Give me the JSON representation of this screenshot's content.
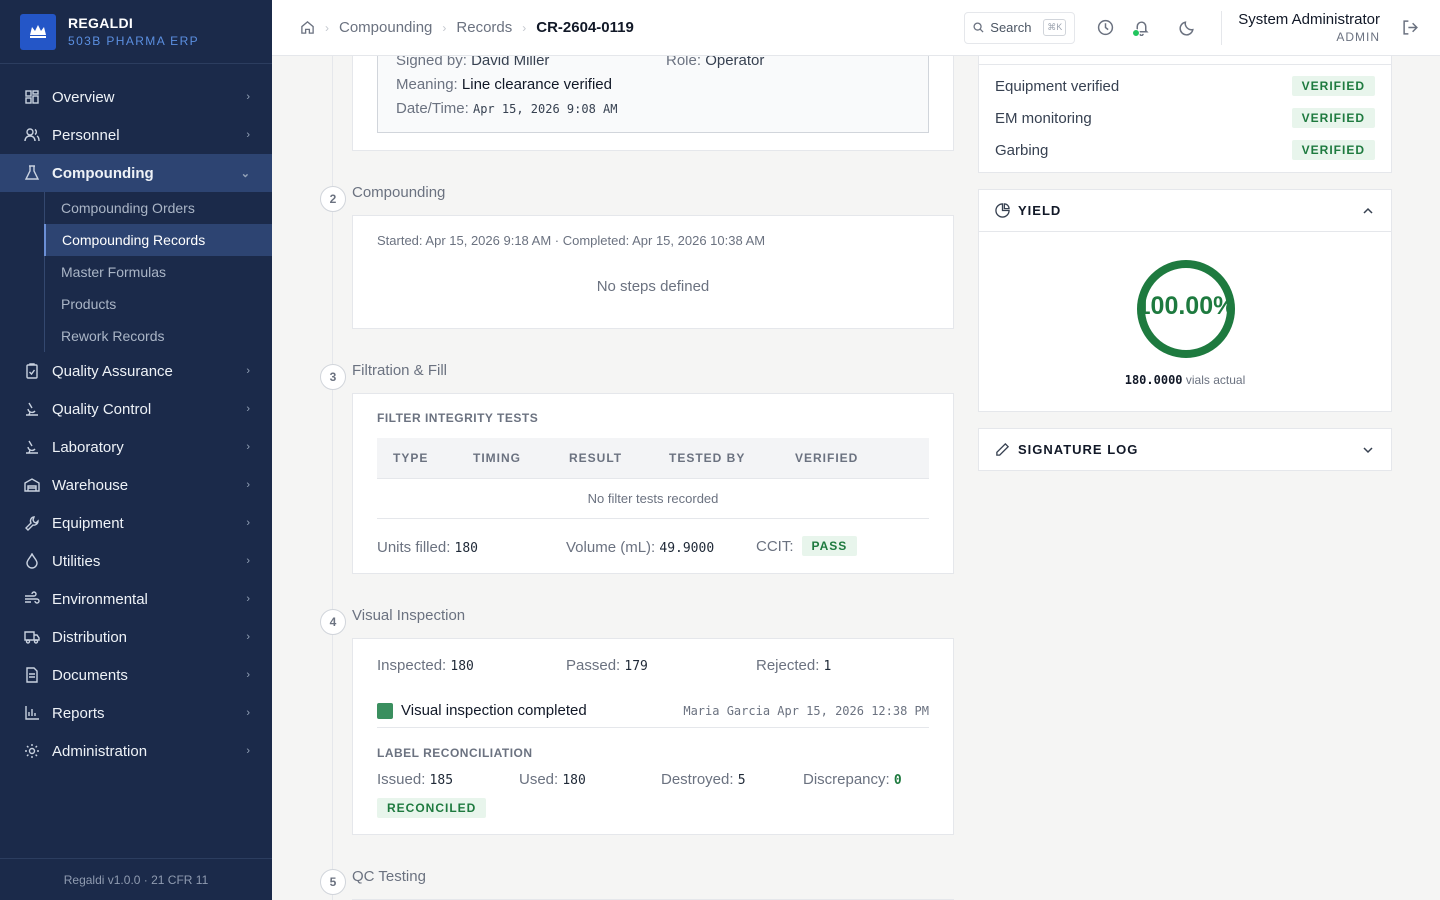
{
  "brand": {
    "name": "REGALDI",
    "subtitle": "503B PHARMA ERP",
    "logo_text": "REGALDI"
  },
  "sidebar": {
    "items": [
      {
        "label": "Overview",
        "icon": "grid-icon"
      },
      {
        "label": "Personnel",
        "icon": "users-icon"
      },
      {
        "label": "Compounding",
        "icon": "flask-icon",
        "active": true,
        "children": [
          "Compounding Orders",
          "Compounding Records",
          "Master Formulas",
          "Products",
          "Rework Records"
        ],
        "active_child": "Compounding Records"
      },
      {
        "label": "Quality Assurance",
        "icon": "clipboard-check-icon"
      },
      {
        "label": "Quality Control",
        "icon": "microscope-icon"
      },
      {
        "label": "Laboratory",
        "icon": "microscope-icon"
      },
      {
        "label": "Warehouse",
        "icon": "warehouse-icon"
      },
      {
        "label": "Equipment",
        "icon": "wrench-icon"
      },
      {
        "label": "Utilities",
        "icon": "droplet-icon"
      },
      {
        "label": "Environmental",
        "icon": "wind-icon"
      },
      {
        "label": "Distribution",
        "icon": "truck-icon"
      },
      {
        "label": "Documents",
        "icon": "document-icon"
      },
      {
        "label": "Reports",
        "icon": "bar-chart-icon"
      },
      {
        "label": "Administration",
        "icon": "gear-icon"
      }
    ],
    "footer": "Regaldi v1.0.0 · 21 CFR 11"
  },
  "header": {
    "breadcrumbs": [
      "Compounding",
      "Records",
      "CR-2604-0119"
    ],
    "search_label": "Search",
    "search_shortcut": "⌘K",
    "user_name": "System Administrator",
    "user_role": "ADMIN"
  },
  "signature": {
    "signed_by_label": "Signed by:",
    "signed_by": "David Miller",
    "role_label": "Role:",
    "role": "Operator",
    "meaning_label": "Meaning:",
    "meaning": "Line clearance verified",
    "datetime_label": "Date/Time:",
    "datetime": "Apr 15, 2026 9:08 AM"
  },
  "steps": {
    "compounding": {
      "num": "2",
      "title": "Compounding",
      "times": "Started: Apr 15, 2026 9:18 AM · Completed: Apr 15, 2026 10:38 AM",
      "empty": "No steps defined"
    },
    "filtration": {
      "num": "3",
      "title": "Filtration & Fill",
      "section_title": "FILTER INTEGRITY TESTS",
      "columns": [
        "TYPE",
        "TIMING",
        "RESULT",
        "TESTED BY",
        "VERIFIED"
      ],
      "empty": "No filter tests recorded",
      "units_label": "Units filled:",
      "units": "180",
      "volume_label": "Volume (mL):",
      "volume": "49.9000",
      "ccit_label": "CCIT:",
      "ccit": "PASS"
    },
    "visual": {
      "num": "4",
      "title": "Visual Inspection",
      "inspected_label": "Inspected:",
      "inspected": "180",
      "passed_label": "Passed:",
      "passed": "179",
      "rejected_label": "Rejected:",
      "rejected": "1",
      "completed_text": "Visual inspection completed",
      "completed_by": "Maria Garcia Apr 15, 2026 12:38 PM",
      "label_section": "LABEL RECONCILIATION",
      "issued_label": "Issued:",
      "issued": "185",
      "used_label": "Used:",
      "used": "180",
      "destroyed_label": "Destroyed:",
      "destroyed": "5",
      "discrepancy_label": "Discrepancy:",
      "discrepancy": "0",
      "reconciled": "RECONCILED"
    },
    "qc": {
      "num": "5",
      "title": "QC Testing"
    }
  },
  "checks": [
    {
      "label": "Equipment verified",
      "status": "VERIFIED"
    },
    {
      "label": "EM monitoring",
      "status": "VERIFIED"
    },
    {
      "label": "Garbing",
      "status": "VERIFIED"
    }
  ],
  "yield": {
    "title": "YIELD",
    "percent_text": "100.00%",
    "percent": 100,
    "actual": "180.0000",
    "actual_label": "vials actual"
  },
  "signature_log": {
    "title": "SIGNATURE LOG"
  },
  "colors": {
    "sidebar": "#1b2a4a",
    "accent": "#1e7a3f",
    "active": "#2d4472"
  }
}
